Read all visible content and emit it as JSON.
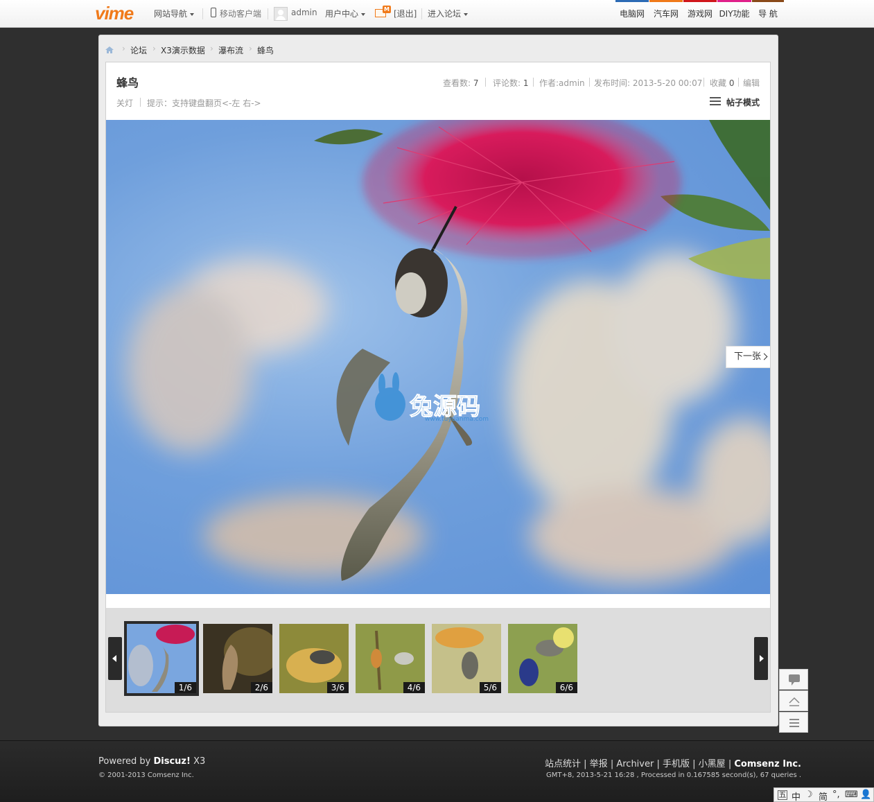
{
  "topbar": {
    "logo": "vime",
    "site_nav": "网站导航",
    "mobile": "移动客户端",
    "username": "admin",
    "user_center": "用户中心",
    "logout": "[退出]",
    "enter_forum": "进入论坛",
    "right_links": [
      {
        "label": "电脑网",
        "color": "#2d6bb5"
      },
      {
        "label": "汽车网",
        "color": "#f07a1a"
      },
      {
        "label": "游戏网",
        "color": "#d0161b"
      },
      {
        "label": "DIY功能",
        "color": "#e0208a"
      },
      {
        "label": "导 航",
        "color": "#8a4a1a"
      }
    ]
  },
  "breadcrumb": [
    "论坛",
    "X3演示数据",
    "瀑布流",
    "蜂鸟"
  ],
  "post": {
    "title": "蜂鸟",
    "views_label": "查看数:",
    "views": "7",
    "comments_label": "评论数:",
    "comments": "1",
    "author": "作者:admin",
    "published": "发布时间: 2013-5-20 00:07",
    "fav_label": "收藏",
    "fav": "0",
    "edit": "编辑",
    "lights_off": "关灯",
    "hint": "提示：支持键盘翻页<-左 右->",
    "post_mode": "帖子模式"
  },
  "viewer": {
    "next_label": "下一张",
    "watermark": "兔源码",
    "watermark_url": "www.tuyuanma.com",
    "thumbs": [
      "1/6",
      "2/6",
      "3/6",
      "4/6",
      "5/6",
      "6/6"
    ],
    "active_index": 0
  },
  "footer": {
    "powered_prefix": "Powered by ",
    "powered_brand": "Discuz!",
    "powered_ver": " X3",
    "copyright": "© 2001-2013 Comsenz Inc.",
    "links": [
      "站点统计",
      "举报",
      "Archiver",
      "手机版",
      "小黑屋"
    ],
    "company": "Comsenz Inc.",
    "stats": "GMT+8, 2013-5-21 16:28 , Processed in 0.167585 second(s), 67 queries ."
  },
  "ime": {
    "lang": "中",
    "mode": "简"
  }
}
